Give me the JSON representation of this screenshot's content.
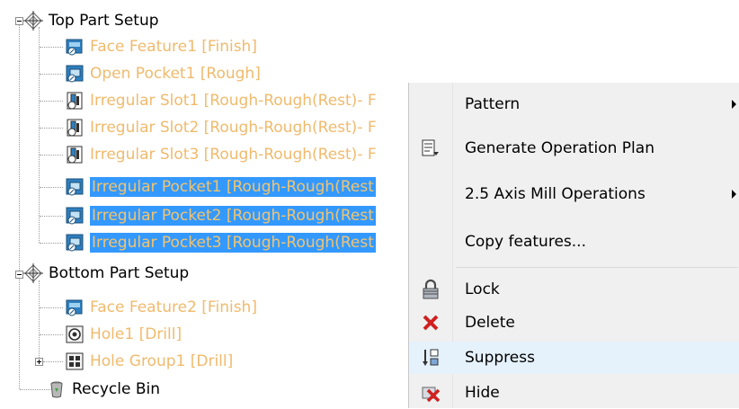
{
  "tree": {
    "top_setup": "Top Part Setup",
    "face_feature1": "Face Feature1 [Finish]",
    "open_pocket1": "Open Pocket1 [Rough]",
    "irregular_slot1": "Irregular Slot1 [Rough-Rough(Rest)- F",
    "irregular_slot2": "Irregular Slot2 [Rough-Rough(Rest)- F",
    "irregular_slot3": "Irregular Slot3 [Rough-Rough(Rest)- F",
    "irregular_pocket1": "Irregular Pocket1 [Rough-Rough(Rest",
    "irregular_pocket2": "Irregular Pocket2 [Rough-Rough(Rest",
    "irregular_pocket3": "Irregular Pocket3 [Rough-Rough(Rest",
    "bottom_setup": "Bottom Part Setup",
    "face_feature2": "Face Feature2 [Finish]",
    "hole1": "Hole1 [Drill]",
    "hole_group1": "Hole Group1 [Drill]",
    "recycle_bin": "Recycle Bin"
  },
  "menu": {
    "pattern": "Pattern",
    "generate_plan": "Generate Operation Plan",
    "mill_ops": "2.5 Axis Mill Operations",
    "copy_features": "Copy features...",
    "lock": "Lock",
    "delete": "Delete",
    "suppress": "Suppress",
    "hide": "Hide"
  },
  "icons": {
    "setup": "setup-crosshair-icon",
    "face": "face-feature-icon",
    "pocket": "pocket-feature-icon",
    "slot": "slot-feature-icon",
    "hole": "hole-feature-icon",
    "hole_group": "hole-group-icon",
    "recycle": "recycle-bin-icon",
    "plan": "operation-plan-icon",
    "lock": "lock-icon",
    "delete": "delete-x-icon",
    "suppress": "suppress-icon",
    "hide": "hide-icon"
  },
  "colors": {
    "selection": "#3399ff",
    "inactive_text": "#f0ba6d",
    "menu_bg": "#f0f0f0",
    "hover": "#e5f1fb"
  }
}
